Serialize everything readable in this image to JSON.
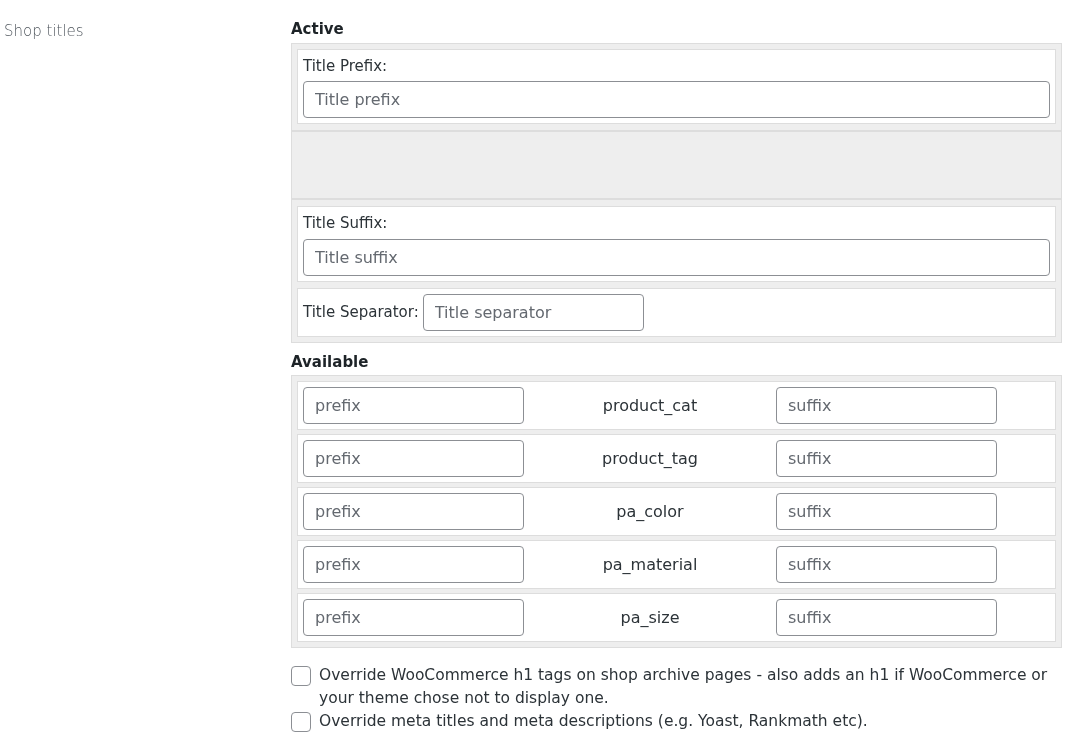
{
  "section_label": "Shop titles",
  "active": {
    "heading": "Active",
    "items": [
      {
        "kind": "stacked",
        "label": "Title Prefix:",
        "placeholder": "Title prefix"
      },
      {
        "kind": "empty"
      },
      {
        "kind": "stacked",
        "label": "Title Suffix:",
        "placeholder": "Title suffix"
      },
      {
        "kind": "inline",
        "label": "Title Separator:",
        "placeholder": "Title separator"
      }
    ]
  },
  "available": {
    "heading": "Available",
    "rows": [
      {
        "prefix_placeholder": "prefix",
        "taxonomy": "product_cat",
        "suffix_placeholder": "suffix"
      },
      {
        "prefix_placeholder": "prefix",
        "taxonomy": "product_tag",
        "suffix_placeholder": "suffix"
      },
      {
        "prefix_placeholder": "prefix",
        "taxonomy": "pa_color",
        "suffix_placeholder": "suffix"
      },
      {
        "prefix_placeholder": "prefix",
        "taxonomy": "pa_material",
        "suffix_placeholder": "suffix"
      },
      {
        "prefix_placeholder": "prefix",
        "taxonomy": "pa_size",
        "suffix_placeholder": "suffix"
      }
    ]
  },
  "options": [
    {
      "label": "Override WooCommerce h1 tags on shop archive pages - also adds an h1 if WooCommerce or your theme chose not to display one.",
      "checked": false
    },
    {
      "label": "Override meta titles and meta descriptions (e.g. Yoast, Rankmath etc).",
      "checked": false
    }
  ]
}
